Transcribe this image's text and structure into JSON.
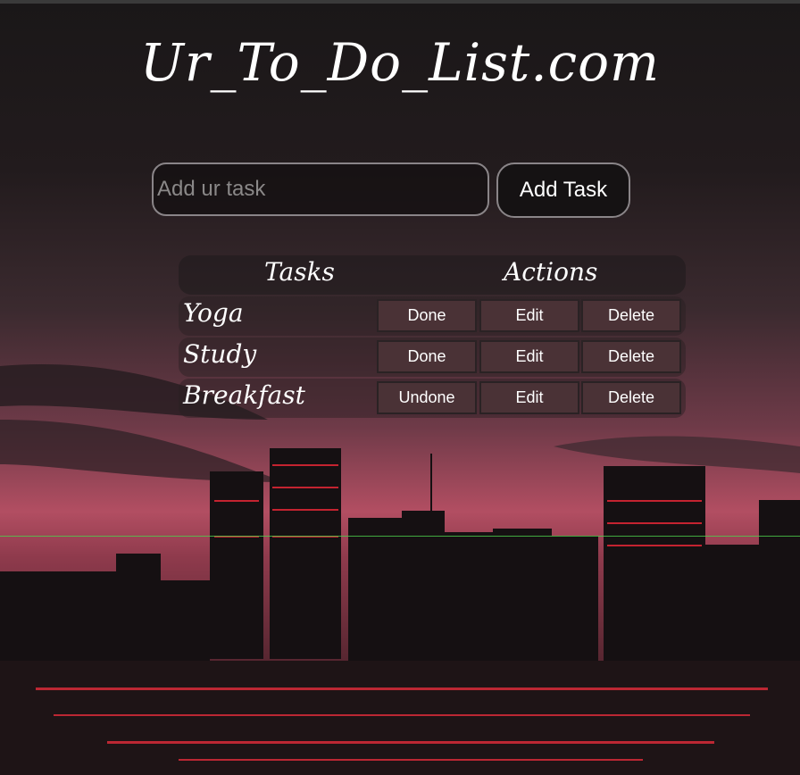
{
  "app": {
    "title": "Ur_To_Do_List.com"
  },
  "input": {
    "placeholder": "Add ur task",
    "value": ""
  },
  "add_button": {
    "label": "Add Task"
  },
  "table": {
    "headers": [
      "Tasks",
      "Actions"
    ],
    "rows": [
      {
        "name": "Yoga",
        "toggle": "Done",
        "edit": "Edit",
        "delete": "Delete"
      },
      {
        "name": "Study",
        "toggle": "Done",
        "edit": "Edit",
        "delete": "Delete"
      },
      {
        "name": "Breakfast",
        "toggle": "Undone",
        "edit": "Edit",
        "delete": "Delete"
      }
    ]
  },
  "colors": {
    "button_bg": "#4a3236",
    "sky_top": "#1b1718",
    "sky_glow": "#a24a5c",
    "city_lights": "#ff2a3a"
  }
}
